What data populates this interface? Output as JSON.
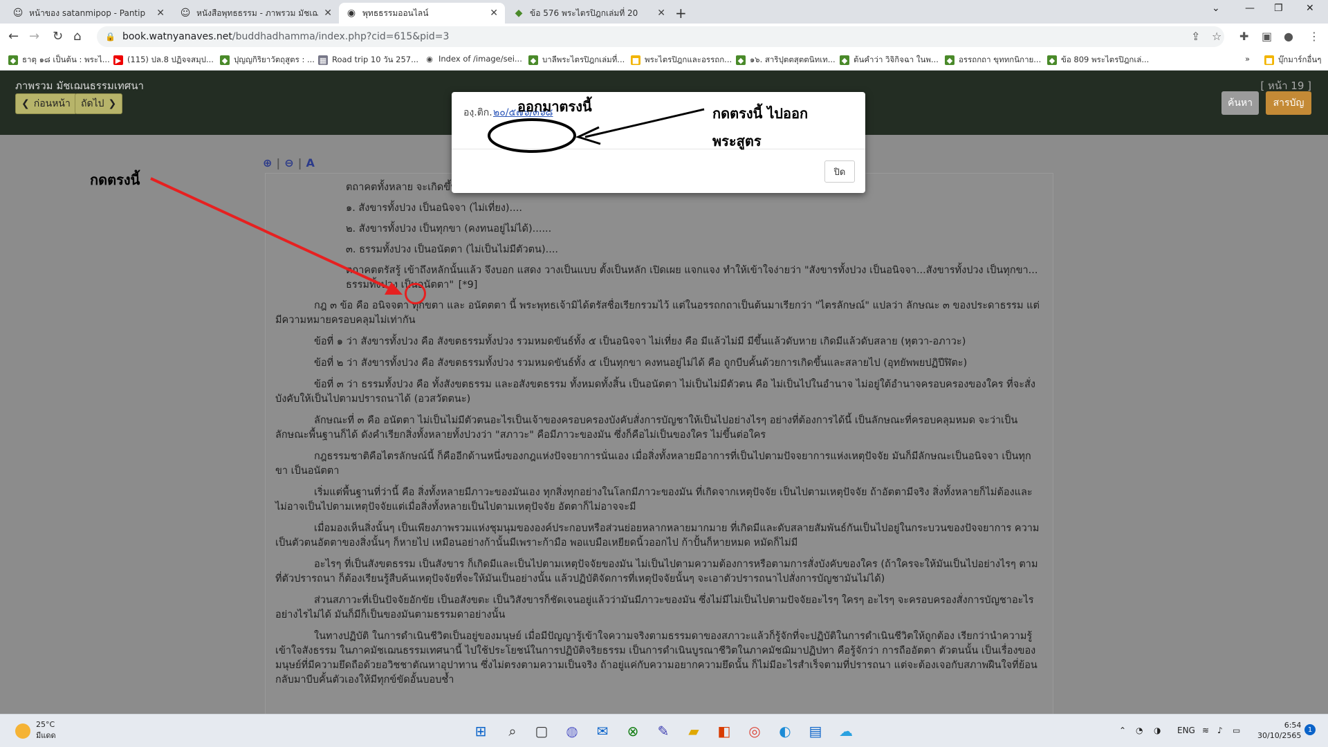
{
  "tabs": [
    {
      "title": "หน้าของ satanmipop - Pantip",
      "icon": "pantip-smiley-icon",
      "active": false
    },
    {
      "title": "หนังสือพุทธธรรม - ภาพรวม มัชเฌนธ",
      "icon": "pantip-smiley-icon",
      "active": false
    },
    {
      "title": "พุทธธรรมออนไลน์",
      "icon": "globe-icon",
      "active": true
    },
    {
      "title": "ข้อ 576 พระไตรปิฎกเล่มที่ 20",
      "icon": "leaf-icon",
      "active": false
    }
  ],
  "address_bar": {
    "domain": "book.watnyanaves.net",
    "path": "/buddhadhamma/index.php?cid=615&pid=3"
  },
  "bookmarks": [
    {
      "label": "ธาตุ ๑๘ เป็นต้น : พระไ...",
      "icon": "leaf-icon"
    },
    {
      "label": "(115) ปล.8 ปฏิจจสมุป...",
      "icon": "youtube-icon"
    },
    {
      "label": "ปุญญกิริยาวัตถุสูตร : ...",
      "icon": "leaf-icon"
    },
    {
      "label": "Road trip 10 วัน 257...",
      "icon": "photo-icon"
    },
    {
      "label": "Index of /image/sei...",
      "icon": "globe-icon"
    },
    {
      "label": "บาลีพระไตรปิฎกเล่มที่...",
      "icon": "leaf-icon"
    },
    {
      "label": "พระไตรปิฎกและอรรถก...",
      "icon": "folder-icon"
    },
    {
      "label": "๑๖. สาริปุตตสุตตนิทเท...",
      "icon": "leaf-icon"
    },
    {
      "label": "ต้นคำว่า วิจิกิจฉา ในพ...",
      "icon": "leaf-icon"
    },
    {
      "label": "อรรถกถา ขุททกนิกาย...",
      "icon": "leaf-icon"
    },
    {
      "label": "ข้อ 809 พระไตรปิฎกเล่...",
      "icon": "leaf-icon"
    },
    {
      "label": "บุ๊กมาร์กอื่นๆ",
      "icon": "folder-icon"
    }
  ],
  "header": {
    "book_title": "ภาพรวม มัชเฌนธรรมเทศนา",
    "prev_label": "ก่อนหน้า",
    "next_label": "ถัดไป",
    "page_no": "[ หน้า 19 ]",
    "search_label": "ค้นหา",
    "toc_label": "สารบัญ"
  },
  "zoom_tools": {
    "zoom_in": "⊕",
    "zoom_out": "⊖",
    "font": "A"
  },
  "content": {
    "intro": "ตถาคตทั้งหลาย จะเกิดขึ้นหรือไม่ก็ตาม ธาตุนั้นก็ยังคงมีอยู่ เป็นธรรมฐิติ เป็นธรรมนิยาม คือ",
    "items": [
      "๑. สังขารทั้งปวง เป็นอนิจจา (ไม่เที่ยง)....",
      "๒. สังขารทั้งปวง เป็นทุกขา (คงทนอยู่ไม่ได้)......",
      "๓. ธรรมทั้งปวง เป็นอนัตตา (ไม่เป็นไม่มีตัวตน)...."
    ],
    "item4": "ตถาคตตรัสรู้ เข้าถึงหลักนั้นแล้ว จึงบอก แสดง วางเป็นแบบ ตั้งเป็นหลัก เปิดเผย แจกแจง ทำให้เข้าใจง่ายว่า \"สังขารทั้งปวง เป็นอนิจจา...สังขารทั้งปวง เป็นทุกขา... ธรรมทั้งปวง เป็นอนัตตา\"",
    "ref_mark": "[*9]",
    "paragraphs": [
      "กฎ ๓ ข้อ คือ อนิจจตา ทุกขตา และ อนัตตตา นี้ พระพุทธเจ้ามิได้ตรัสชื่อเรียกรวมไว้ แต่ในอรรถกถาเป็นต้นมาเรียกว่า \"ไตรลักษณ์\" แปลว่า ลักษณะ ๓ ของประดาธรรม แต่มีความหมายครอบคลุมไม่เท่ากัน",
      "ข้อที่ ๑ ว่า สังขารทั้งปวง คือ สังขตธรรมทั้งปวง รวมหมดขันธ์ทั้ง ๕ เป็นอนิจจา ไม่เที่ยง คือ มีแล้วไม่มี มีขึ้นแล้วดับหาย เกิดมีแล้วดับสลาย (หุตวา-อภาวะ)",
      "ข้อที่ ๒ ว่า สังขารทั้งปวง คือ สังขตธรรมทั้งปวง รวมหมดขันธ์ทั้ง ๕ เป็นทุกขา คงทนอยู่ไม่ได้ คือ ถูกบีบคั้นด้วยการเกิดขึ้นและสลายไป (อุทยัพพยปฏิปีฬิตะ)",
      "ข้อที่ ๓ ว่า ธรรมทั้งปวง คือ ทั้งสังขตธรรม และอสังขตธรรม ทั้งหมดทั้งสิ้น เป็นอนัตตา ไม่เป็นไม่มีตัวตน คือ ไม่เป็นไปในอำนาจ ไม่อยู่ใต้อำนาจครอบครองของใคร ที่จะสั่งบังคับให้เป็นไปตามปรารถนาได้ (อวสวัตตนะ)",
      "ลักษณะที่ ๓ คือ อนัตตา ไม่เป็นไม่มีตัวตนอะไรเป็นเจ้าของครอบครองบังคับสั่งการบัญชาให้เป็นไปอย่างไรๆ อย่างที่ต้องการได้นี้ เป็นลักษณะที่ครอบคลุมหมด จะว่าเป็นลักษณะพื้นฐานก็ได้ ดังคำเรียกสิ่งทั้งหลายทั้งปวงว่า \"สภาวะ\" คือมีภาวะของมัน ซึ่งก็คือไม่เป็นของใคร ไม่ขึ้นต่อใคร",
      "กฎธรรมชาติคือไตรลักษณ์นี้ ก็คืออีกด้านหนึ่งของกฎแห่งปัจจยาการนั่นเอง เมื่อสิ่งทั้งหลายมีอาการที่เป็นไปตามปัจจยาการแห่งเหตุปัจจัย มันก็มีลักษณะเป็นอนิจจา เป็นทุกขา เป็นอนัตตา",
      "เริ่มแต่พื้นฐานที่ว่านี้ คือ สิ่งทั้งหลายมีภาวะของมันเอง ทุกสิ่งทุกอย่างในโลกมีภาวะของมัน ที่เกิดจากเหตุปัจจัย เป็นไปตามเหตุปัจจัย ถ้าอัตตามีจริง สิ่งทั้งหลายก็ไม่ต้องและไม่อาจเป็นไปตามเหตุปัจจัยแต่เมื่อสิ่งทั้งหลายเป็นไปตามเหตุปัจจัย อัตตาก็ไม่อาจจะมี",
      "เมื่อมองเห็นสิ่งนั้นๆ เป็นเพียงภาพรวมแห่งชุมนุมขององค์ประกอบหรือส่วนย่อยหลากหลายมากมาย ที่เกิดมีและดับสลายสัมพันธ์กันเป็นไปอยู่ในกระบวนของปัจจยาการ ความเป็นตัวตนอัตตาของสิ่งนั้นๆ ก็หายไป เหมือนอย่างก้านั้นมีเพราะก้ามือ พอแบมือเหยียดนิ้วออกไป ก้าปั้นก็หายหมด หมัดก็ไม่มี",
      "อะไรๆ ที่เป็นสังขตธรรม เป็นสังขาร ก็เกิดมีและเป็นไปตามเหตุปัจจัยของมัน ไม่เป็นไปตามความต้องการหรือตามการสั่งบังคับของใคร (ถ้าใครจะให้มันเป็นไปอย่างไรๆ ตามที่ตัวปรารถนา ก็ต้องเรียนรู้สืบค้นเหตุปัจจัยที่จะให้มันเป็นอย่างนั้น แล้วปฏิบัติจัดการที่เหตุปัจจัยนั้นๆ จะเอาตัวปรารถนาไปสั่งการบัญชามันไม่ได้)",
      "ส่วนสภาวะที่เป็นปัจจัยอักขัย เป็นอสังขตะ เป็นวิสังขารก็ชัดเจนอยู่แล้วว่ามันมีภาวะของมัน ซึ่งไม่มีไม่เป็นไปตามปัจจัยอะไรๆ ใครๆ อะไรๆ จะครอบครองสั่งการบัญชาอะไรอย่างไรไม่ได้ มันก็มีก็เป็นของมันตามธรรมดาอย่างนั้น",
      "ในทางปฏิบัติ ในการดำเนินชีวิตเป็นอยู่ของมนุษย์ เมื่อมีปัญญารู้เข้าใจความจริงตามธรรมดาของสภาวะแล้วก็รู้จักที่จะปฏิบัติในการดำเนินชีวิตให้ถูกต้อง เรียกว่านำความรู้เข้าใจสังธรรม ในภาคมัชเฌนธรรมเทศนานี้ ไปใช้ประโยชน์ในการปฏิบัติจริยธรรม เป็นการดำเนินบูรณาชีวิตในภาคมัชฌิมาปฏิปทา คือรู้จักว่า การถืออัตตา ตัวตนนั้น เป็นเรื่องของมนุษย์ที่มีความยึดถือด้วยอวิชชาตัณหาอุปาทาน ซึ่งไม่ตรงตามความเป็นจริง ถ้าอยู่แค่กับความอยากความยึดนั้น ก็ไม่มีอะไรสำเร็จตามที่ปรารถนา แต่จะต้องเจอกับสภาพฝืนใจที่ย้อนกลับมาบีบคั้นตัวเองให้มีทุกข์ขัดอั้นบอบช้ำ"
    ]
  },
  "modal": {
    "label": "องฺ.ติก.",
    "ref_link": "๒๐/๕๗๖/๓๖๘",
    "close_label": "ปิด"
  },
  "annotations": {
    "press_here": "กดตรงนี้",
    "pops_out_here": "ออกมาตรงนี้",
    "press_here_goto_line1": "กดตรงนี้ ไปออก",
    "press_here_goto_line2": "พระสูตร",
    "arrow_color": "#e62020"
  },
  "taskbar": {
    "temperature": "25°C",
    "weather_desc": "มีแดด",
    "language": "ENG",
    "time": "6:54",
    "date": "30/10/2565",
    "notifications": "1",
    "apps": [
      "windows-start-icon",
      "search-icon",
      "task-view-icon",
      "teams-icon",
      "mail-icon",
      "xbox-icon",
      "pen-icon",
      "file-explorer-icon",
      "office-icon",
      "chrome-icon",
      "edge-icon",
      "store-icon",
      "weather-app-icon"
    ]
  }
}
